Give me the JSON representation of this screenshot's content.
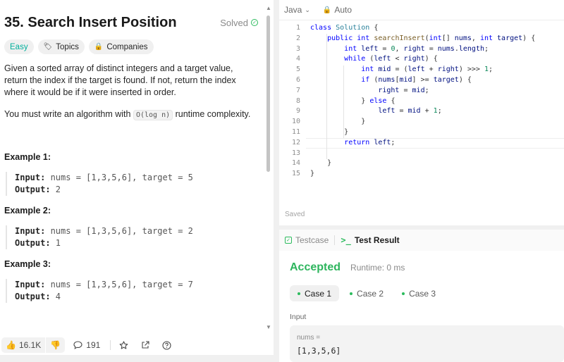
{
  "problem": {
    "title": "35. Search Insert Position",
    "status": "Solved",
    "tags": [
      "Easy",
      "Topics",
      "Companies"
    ],
    "description": "Given a sorted array of distinct integers and a target value, return the index if the target is found. If not, return the index where it would be if it were inserted in order.",
    "complexity_prefix": "You must write an algorithm with ",
    "complexity_code": "O(log n)",
    "complexity_suffix": " runtime complexity.",
    "examples": [
      {
        "title": "Example 1:",
        "input_label": "Input:",
        "input": " nums = [1,3,5,6], target = 5",
        "output_label": "Output:",
        "output": " 2"
      },
      {
        "title": "Example 2:",
        "input_label": "Input:",
        "input": " nums = [1,3,5,6], target = 2",
        "output_label": "Output:",
        "output": " 1"
      },
      {
        "title": "Example 3:",
        "input_label": "Input:",
        "input": " nums = [1,3,5,6], target = 7",
        "output_label": "Output:",
        "output": " 4"
      }
    ]
  },
  "footer": {
    "likes": "16.1K",
    "comments": "191"
  },
  "editor": {
    "language": "Java",
    "mode": "Auto",
    "saved_label": "Saved",
    "active_line": 12,
    "lines": [
      "class Solution {",
      "    public int searchInsert(int[] nums, int target) {",
      "        int left = 0, right = nums.length;",
      "        while (left < right) {",
      "            int mid = (left + right) >>> 1;",
      "            if (nums[mid] >= target) {",
      "                right = mid;",
      "            } else {",
      "                left = mid + 1;",
      "            }",
      "        }",
      "        return left;",
      "",
      "    }",
      "}"
    ]
  },
  "results": {
    "tabs": [
      "Testcase",
      "Test Result"
    ],
    "verdict": "Accepted",
    "runtime": "Runtime: 0 ms",
    "cases": [
      "Case 1",
      "Case 2",
      "Case 3"
    ],
    "input_label": "Input",
    "input_name": "nums =",
    "input_value": "[1,3,5,6]"
  },
  "colors": {
    "accepted": "#2db55d",
    "easy": "#00af9b",
    "keyword": "#0000ff"
  }
}
